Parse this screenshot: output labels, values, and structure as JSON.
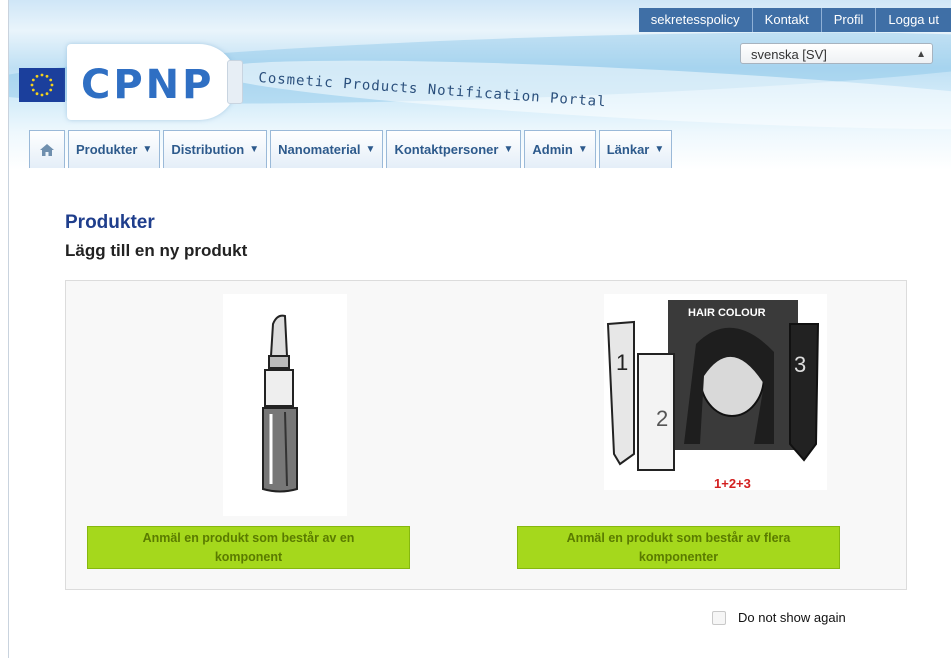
{
  "header": {
    "top_links": [
      "sekretesspolicy",
      "Kontakt",
      "Profil",
      "Logga ut"
    ],
    "language_selected": "svenska [SV]",
    "logo_text": "CPNP",
    "tagline": "Cosmetic Products Notification Portal"
  },
  "nav": {
    "home_icon": "home-icon",
    "tabs": [
      "Produkter",
      "Distribution",
      "Nanomaterial",
      "Kontaktpersoner",
      "Admin",
      "Länkar"
    ]
  },
  "page": {
    "title": "Produkter",
    "subtitle": "Lägg till en ny produkt"
  },
  "options": {
    "single_button": "Anmäl en produkt som består av en komponent",
    "multi_button": "Anmäl en produkt som består av flera komponenter",
    "multi_image_text": "HAIR COLOUR",
    "multi_image_numbers": "1+2+3"
  },
  "footer": {
    "do_not_show": "Do not show again"
  },
  "colors": {
    "accent": "#2f6fc3",
    "button_green": "#a5d81c",
    "title_blue": "#1f3e8c"
  }
}
